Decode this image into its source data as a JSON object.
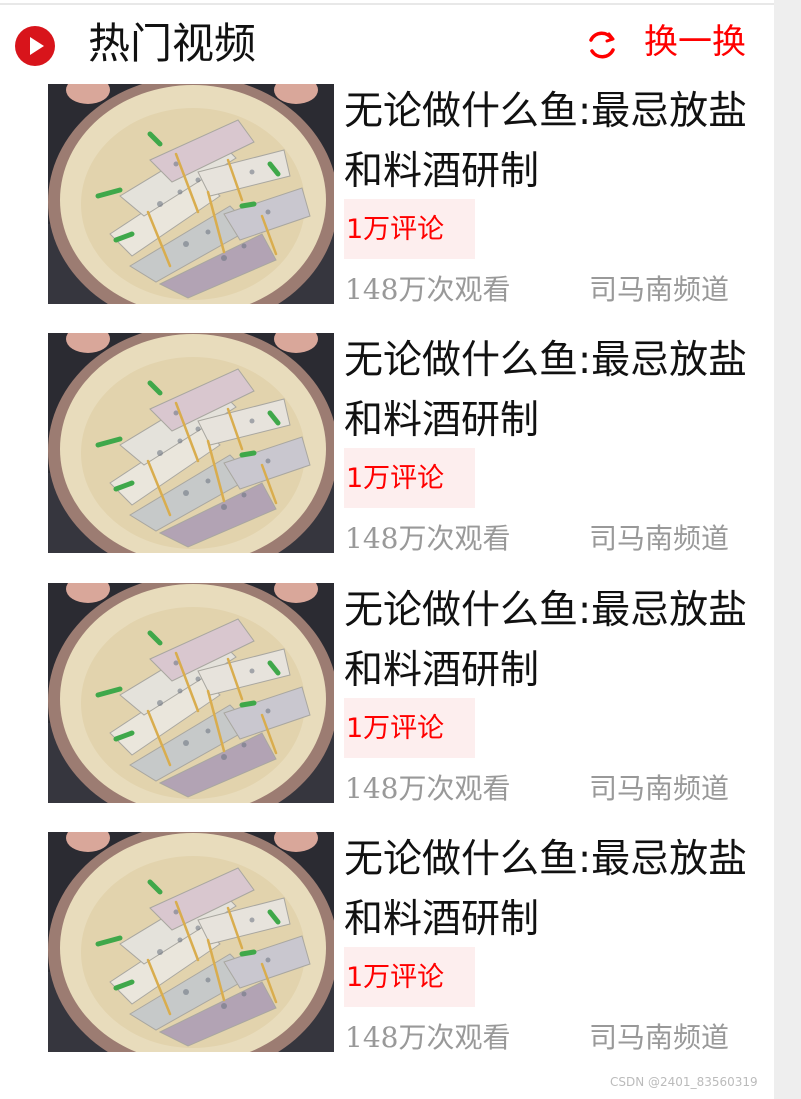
{
  "header": {
    "logo_icon": "play-circle-icon",
    "title": "热门视频",
    "refresh_icon": "refresh-icon",
    "refresh_label": "换一换",
    "accent_color": "#ff0000",
    "logo_color": "#d8141b"
  },
  "videos": [
    {
      "thumbnail": "fish-dish-thumbnail",
      "title": "无论做什么鱼:最忌放盐和料酒研制",
      "comments": "1万评论",
      "views": "148万次观看",
      "channel": "司马南频道"
    },
    {
      "thumbnail": "fish-dish-thumbnail",
      "title": "无论做什么鱼:最忌放盐和料酒研制",
      "comments": "1万评论",
      "views": "148万次观看",
      "channel": "司马南频道"
    },
    {
      "thumbnail": "fish-dish-thumbnail",
      "title": "无论做什么鱼:最忌放盐和料酒研制",
      "comments": "1万评论",
      "views": "148万次观看",
      "channel": "司马南频道"
    },
    {
      "thumbnail": "fish-dish-thumbnail",
      "title": "无论做什么鱼:最忌放盐和料酒研制",
      "comments": "1万评论",
      "views": "148万次观看",
      "channel": "司马南频道"
    }
  ],
  "watermark": "CSDN @2401_83560319"
}
